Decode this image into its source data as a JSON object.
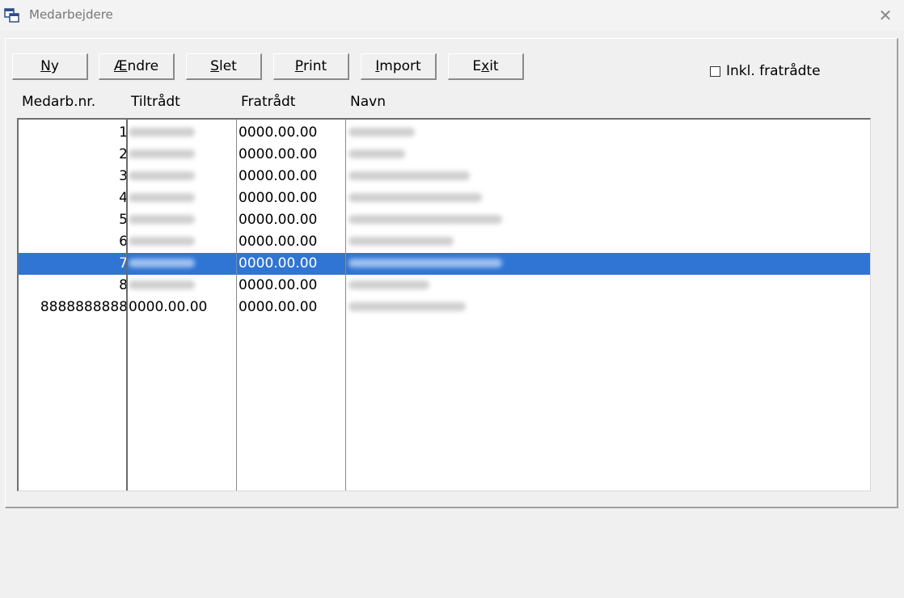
{
  "window": {
    "title": "Medarbejdere",
    "close_symbol": "✕"
  },
  "toolbar": {
    "buttons": [
      {
        "pre": "",
        "accel": "N",
        "post": "y"
      },
      {
        "pre": "",
        "accel": "Æ",
        "post": "ndre"
      },
      {
        "pre": "",
        "accel": "S",
        "post": "let"
      },
      {
        "pre": "",
        "accel": "P",
        "post": "rint"
      },
      {
        "pre": "",
        "accel": "I",
        "post": "mport"
      },
      {
        "pre": "E",
        "accel": "x",
        "post": "it"
      }
    ],
    "checkbox": {
      "label": "Inkl. fratrådte",
      "checked": false
    }
  },
  "columns": [
    "Medarb.nr.",
    "Tiltrådt",
    "Fratrådt",
    "Navn"
  ],
  "rows": [
    {
      "nr": "1",
      "tiltraadt": "",
      "fratraadt": "0000.00.00",
      "navn": "",
      "selected": false
    },
    {
      "nr": "2",
      "tiltraadt": "",
      "fratraadt": "0000.00.00",
      "navn": "",
      "selected": false
    },
    {
      "nr": "3",
      "tiltraadt": "",
      "fratraadt": "0000.00.00",
      "navn": "",
      "selected": false
    },
    {
      "nr": "4",
      "tiltraadt": "",
      "fratraadt": "0000.00.00",
      "navn": "",
      "selected": false
    },
    {
      "nr": "5",
      "tiltraadt": "",
      "fratraadt": "0000.00.00",
      "navn": "",
      "selected": false
    },
    {
      "nr": "6",
      "tiltraadt": "",
      "fratraadt": "0000.00.00",
      "navn": "",
      "selected": false
    },
    {
      "nr": "7",
      "tiltraadt": "",
      "fratraadt": "0000.00.00",
      "navn": "",
      "selected": true
    },
    {
      "nr": "8",
      "tiltraadt": "",
      "fratraadt": "0000.00.00",
      "navn": "",
      "selected": false
    },
    {
      "nr": "8888888888",
      "tiltraadt": "0000.00.00",
      "fratraadt": "0000.00.00",
      "navn": "",
      "selected": false
    }
  ],
  "colors": {
    "selection": "#3074d4",
    "selection_text": "#ffffff"
  }
}
